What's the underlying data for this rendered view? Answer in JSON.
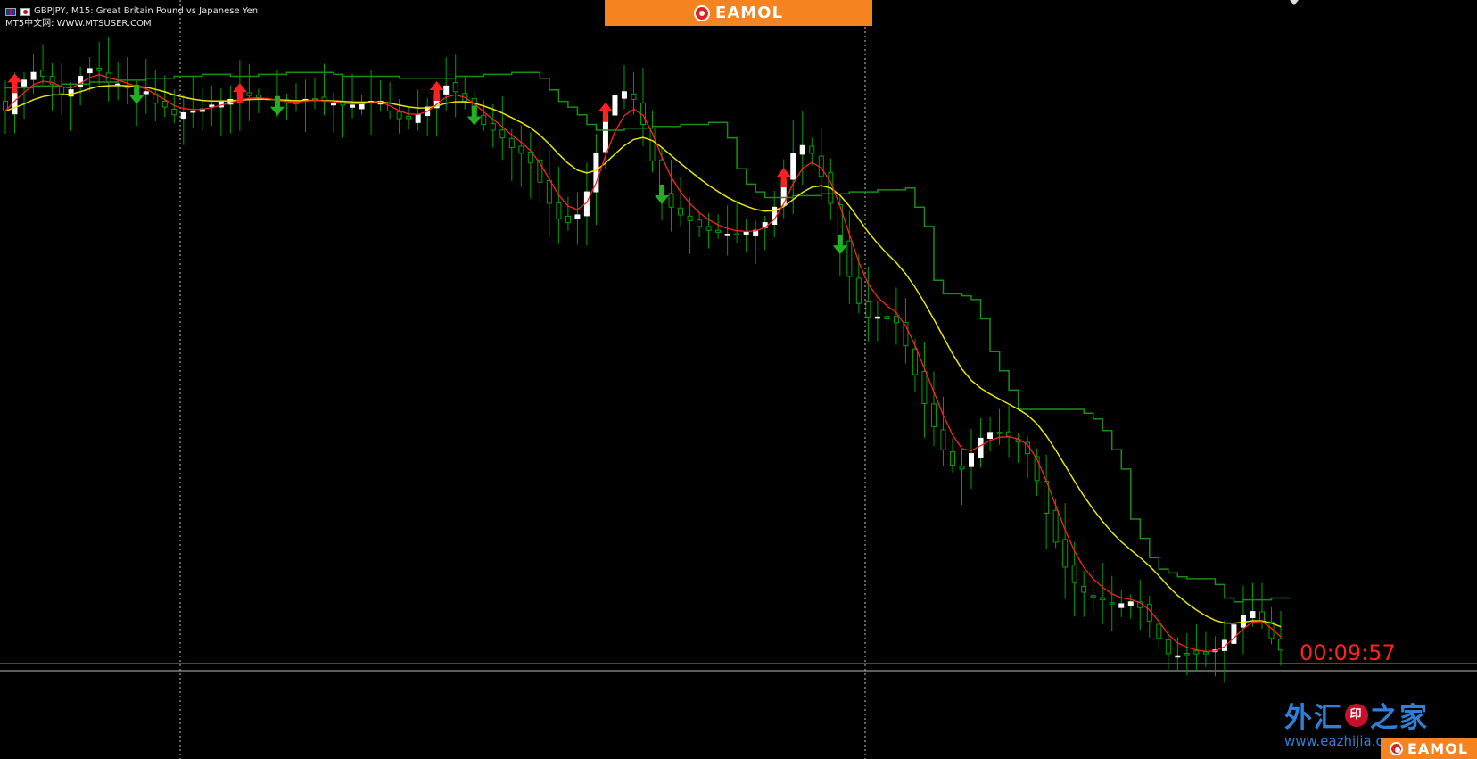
{
  "header": {
    "symbol_line": "GBPJPY, M15:  Great Britain Pound vs Japanese Yen",
    "source_line": "MT5中文网: WWW.MTSUSER.COM"
  },
  "banner": {
    "brand": "EAMOL"
  },
  "timer": "00:09:57",
  "watermark": {
    "title_left": "外汇",
    "badge": "印",
    "title_right": "之家",
    "url": "www.eazhijia.com"
  },
  "colors": {
    "background": "#000000",
    "bull_candle": "#ffffff",
    "bear_candle": "#00a000",
    "fast_ma": "#ff2020",
    "slow_ma": "#e6e600",
    "stop_line": "#1a8c1a",
    "buy_arrow": "#ff2020",
    "sell_arrow": "#21b021",
    "price_line": "#cc1010",
    "banner": "#f5831f"
  },
  "chart_data": {
    "type": "candlestick",
    "symbol": "GBPJPY",
    "timeframe": "M15",
    "time_to_bar_close": "00:09:57",
    "close_series": [
      149.62,
      149.75,
      149.78,
      149.82,
      149.8,
      149.76,
      149.71,
      149.73,
      149.8,
      149.84,
      149.83,
      149.77,
      149.76,
      149.74,
      149.72,
      149.72,
      149.66,
      149.64,
      149.6,
      149.61,
      149.62,
      149.63,
      149.65,
      149.67,
      149.68,
      149.7,
      149.7,
      149.69,
      149.68,
      149.66,
      149.66,
      149.66,
      149.68,
      149.68,
      149.67,
      149.66,
      149.65,
      149.65,
      149.66,
      149.67,
      149.67,
      149.62,
      149.58,
      149.58,
      149.6,
      149.64,
      149.71,
      149.75,
      149.72,
      149.67,
      149.61,
      149.55,
      149.52,
      149.48,
      149.43,
      149.4,
      149.35,
      149.25,
      149.14,
      149.06,
      149.04,
      149.08,
      149.2,
      149.4,
      149.6,
      149.7,
      149.72,
      149.68,
      149.55,
      149.36,
      149.2,
      149.12,
      149.08,
      149.05,
      149.02,
      149,
      148.99,
      148.98,
      148.98,
      148.99,
      149,
      149.04,
      149.12,
      149.26,
      149.4,
      149.44,
      149.4,
      149.28,
      149.14,
      148.94,
      148.76,
      148.62,
      148.55,
      148.55,
      148.54,
      148.52,
      148.4,
      148.25,
      148.1,
      147.98,
      147.86,
      147.78,
      147.76,
      147.84,
      147.92,
      147.95,
      147.95,
      147.93,
      147.9,
      147.84,
      147.7,
      147.53,
      147.38,
      147.25,
      147.17,
      147.12,
      147.1,
      147.08,
      147.06,
      147.06,
      147.07,
      147.04,
      146.97,
      146.88,
      146.8,
      146.79,
      146.8,
      146.8,
      146.8,
      146.82,
      146.87,
      146.95,
      147,
      147.02,
      146.97,
      146.88,
      146.82
    ],
    "fast_ma_period": "red",
    "slow_ma_period": "yellow",
    "trailing_stop": "green step line",
    "buy_signals": "red up arrows",
    "sell_signals": "green down arrows",
    "grid": "vertical dotted separators",
    "current_price_line": "red horizontal"
  }
}
